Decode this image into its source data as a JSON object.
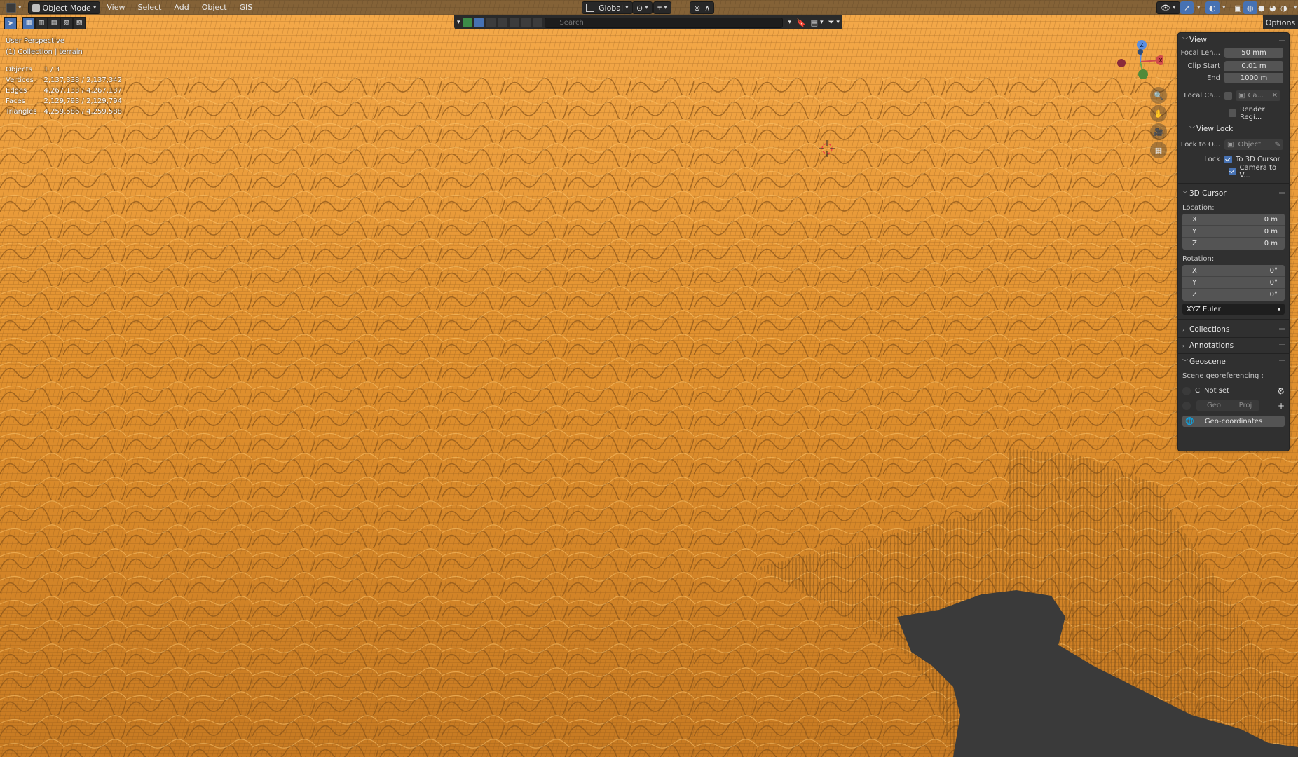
{
  "header": {
    "editor_icon": "3d-viewport-icon",
    "mode_label": "Object Mode",
    "menus": [
      "View",
      "Select",
      "Add",
      "Object",
      "GIS"
    ],
    "orientation_label": "Global",
    "options_label": "Options"
  },
  "search": {
    "placeholder": "Search"
  },
  "overlay": {
    "view_name": "User Perspective",
    "collection": "(1) Collection | terrain",
    "stats": [
      {
        "label": "Objects",
        "value": "1 / 3"
      },
      {
        "label": "Vertices",
        "value": "2,137,338 / 2,137,342"
      },
      {
        "label": "Edges",
        "value": "4,267,133 / 4,267,137"
      },
      {
        "label": "Faces",
        "value": "2,129,793 / 2,129,794"
      },
      {
        "label": "Triangles",
        "value": "4,259,586 / 4,259,588"
      }
    ]
  },
  "gizmo": {
    "x": "X",
    "y": "Y",
    "z": "Z"
  },
  "npanel": {
    "view": {
      "title": "View",
      "focal_length_label": "Focal Len...",
      "focal_length_value": "50 mm",
      "clip_start_label": "Clip Start",
      "clip_start_value": "0.01 m",
      "clip_end_label": "End",
      "clip_end_value": "1000 m",
      "local_camera_label": "Local Ca...",
      "local_camera_value": "Ca...",
      "render_region_label": "Render Regi...",
      "view_lock_title": "View Lock",
      "lock_to_object_label": "Lock to O...",
      "lock_to_object_placeholder": "Object",
      "lock_label": "Lock",
      "lock_to_cursor_label": "To 3D Cursor",
      "lock_camera_label": "Camera to V..."
    },
    "cursor": {
      "title": "3D Cursor",
      "location_label": "Location:",
      "location": [
        {
          "axis": "X",
          "value": "0 m"
        },
        {
          "axis": "Y",
          "value": "0 m"
        },
        {
          "axis": "Z",
          "value": "0 m"
        }
      ],
      "rotation_label": "Rotation:",
      "rotation": [
        {
          "axis": "X",
          "value": "0°"
        },
        {
          "axis": "Y",
          "value": "0°"
        },
        {
          "axis": "Z",
          "value": "0°"
        }
      ],
      "rotation_mode": "XYZ Euler"
    },
    "collections_title": "Collections",
    "annotations_title": "Annotations",
    "geoscene": {
      "title": "Geoscene",
      "georef_label": "Scene georeferencing :",
      "crs_letter": "C",
      "status": "Not set",
      "geo_label": "Geo",
      "proj_label": "Proj",
      "geo_coords_button": "Geo-coordinates"
    }
  },
  "colors": {
    "wire": "#e89a36",
    "background": "#2b2b2b",
    "accent": "#4772b3"
  }
}
